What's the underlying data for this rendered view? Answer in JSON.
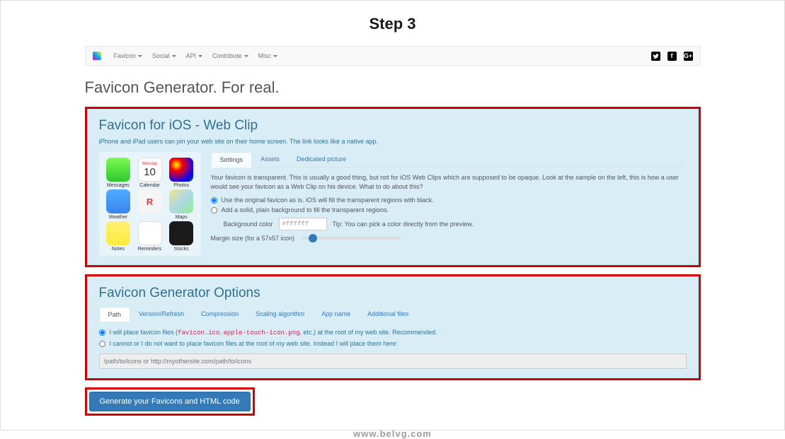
{
  "step_title": "Step 3",
  "nav": {
    "items": [
      "Favicon",
      "Social",
      "API",
      "Contribute",
      "Misc"
    ]
  },
  "main_heading": "Favicon Generator. For real.",
  "ios": {
    "heading": "Favicon for iOS - Web Clip",
    "sub": "iPhone and iPad users can pin your web site on their home screen. The link looks like a native app.",
    "apps": {
      "messages": "Messages",
      "calendar": "Calendar",
      "cal_day": "Monday",
      "cal_num": "10",
      "photos": "Photos",
      "weather": "Weather",
      "app2_label": "",
      "app2_text": "R",
      "maps": "Maps",
      "notes": "Notes",
      "reminders": "Reminders",
      "stocks": "Stocks"
    },
    "tabs": {
      "settings": "Settings",
      "assets": "Assets",
      "dedicated": "Dedicated picture"
    },
    "desc": "Your favicon is transparent. This is usually a good thing, but not for iOS Web Clips which are supposed to be opaque. Look at the sample on the left, this is how a user would see your favicon as a Web Clip on his device. What to do about this?",
    "radio1": "Use the original favicon as is. iOS will fill the transparent regions with black.",
    "radio2": "Add a solid, plain background to fill the transparent regions.",
    "bg_label": "Background color",
    "bg_value": "#ffffff",
    "bg_tip": "Tip: You can pick a color directly from the preview.",
    "margin_label": "Margin size (for a 57x57 icon)"
  },
  "options": {
    "heading": "Favicon Generator Options",
    "tabs": {
      "path": "Path",
      "version": "Version/Refresh",
      "compression": "Compression",
      "scaling": "Scaling algorithm",
      "appname": "App name",
      "additional": "Additional files"
    },
    "radio1_pre": "I will place favicon files (",
    "radio1_code1": "favicon.ico",
    "radio1_sep": ", ",
    "radio1_code2": "apple-touch-icon.png",
    "radio1_post": ", etc.) at the root of my web site. Recommended.",
    "radio2": "I cannot or I do not want to place favicon files at the root of my web site. Instead I will place them here:",
    "path_placeholder": "/path/to/icons or http://myothersite.com/path/to/icons"
  },
  "generate_label": "Generate your Favicons and HTML code",
  "footer": "www.belvg.com"
}
